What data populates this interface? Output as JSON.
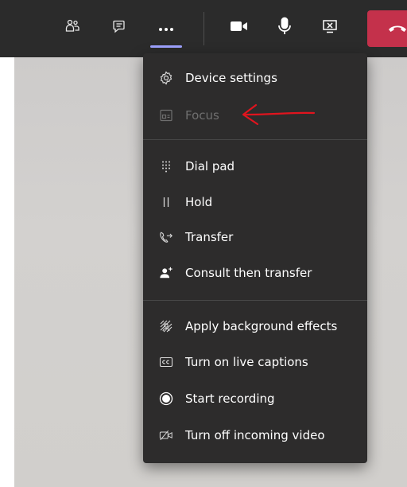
{
  "toolbar": {
    "icons": {
      "people": "people-icon",
      "chat": "chat-icon",
      "more": "more-options-icon",
      "camera": "camera-icon",
      "mic": "microphone-icon",
      "share": "share-screen-icon",
      "hangup": "hang-up-icon"
    },
    "accent_color": "#9ea2ff",
    "hangup_color": "#c4314b"
  },
  "menu": {
    "items": [
      {
        "label": "Device settings",
        "icon": "gear-icon",
        "enabled": true
      },
      {
        "label": "Focus",
        "icon": "focus-icon",
        "enabled": false
      },
      {
        "label": "Dial pad",
        "icon": "dial-pad-icon",
        "enabled": true
      },
      {
        "label": "Hold",
        "icon": "hold-icon",
        "enabled": true
      },
      {
        "label": "Transfer",
        "icon": "transfer-icon",
        "enabled": true
      },
      {
        "label": "Consult then transfer",
        "icon": "consult-transfer-icon",
        "enabled": true
      },
      {
        "label": "Apply background effects",
        "icon": "background-effects-icon",
        "enabled": true
      },
      {
        "label": "Turn on live captions",
        "icon": "captions-icon",
        "enabled": true
      },
      {
        "label": "Start recording",
        "icon": "record-icon",
        "enabled": true
      },
      {
        "label": "Turn off incoming video",
        "icon": "video-off-icon",
        "enabled": true
      }
    ]
  },
  "annotation": {
    "color": "#e0141e"
  }
}
